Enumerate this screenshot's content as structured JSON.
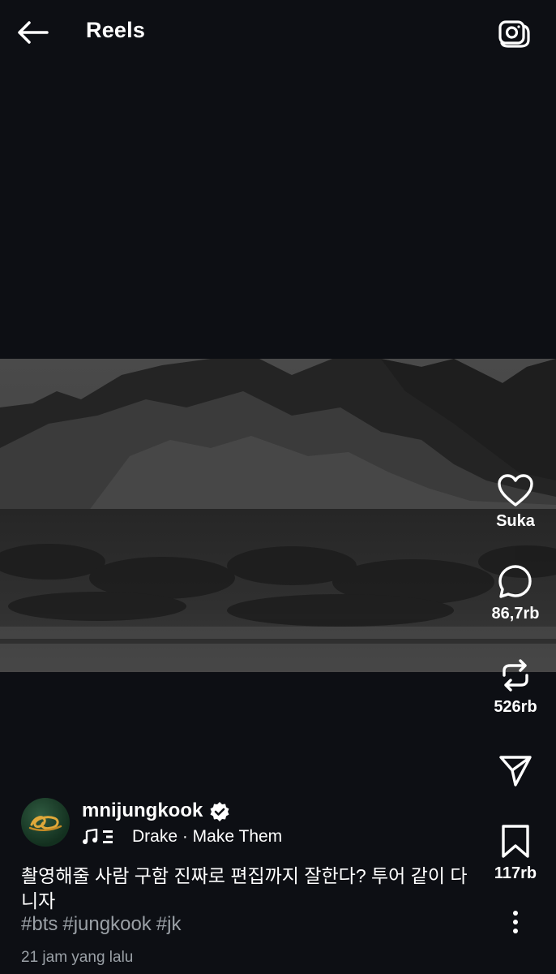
{
  "header": {
    "title": "Reels",
    "back_icon": "arrow-left-icon",
    "camera_icon": "camera-icon"
  },
  "actions": {
    "like": {
      "icon": "heart-icon",
      "label": "Suka"
    },
    "comment": {
      "icon": "comment-icon",
      "count": "86,7rb"
    },
    "repost": {
      "icon": "repost-icon",
      "count": "526rb"
    },
    "share": {
      "icon": "send-icon"
    },
    "save": {
      "icon": "bookmark-icon",
      "count": "117rb"
    },
    "more": {
      "icon": "more-vertical-icon"
    }
  },
  "post": {
    "username": "mnijungkook",
    "verified": true,
    "audio": "Drake · Make Them",
    "caption": "촬영해줄 사람 구함 진짜로 편집까지 잘한다? 투어 같이 다니자",
    "hashtags": [
      "#bts",
      "#jungkook",
      "#jk"
    ],
    "timestamp": "21 jam yang lalu"
  },
  "colors": {
    "background": "#0d0f14",
    "text": "#ffffff",
    "secondary_text": "#9aa0a6"
  }
}
